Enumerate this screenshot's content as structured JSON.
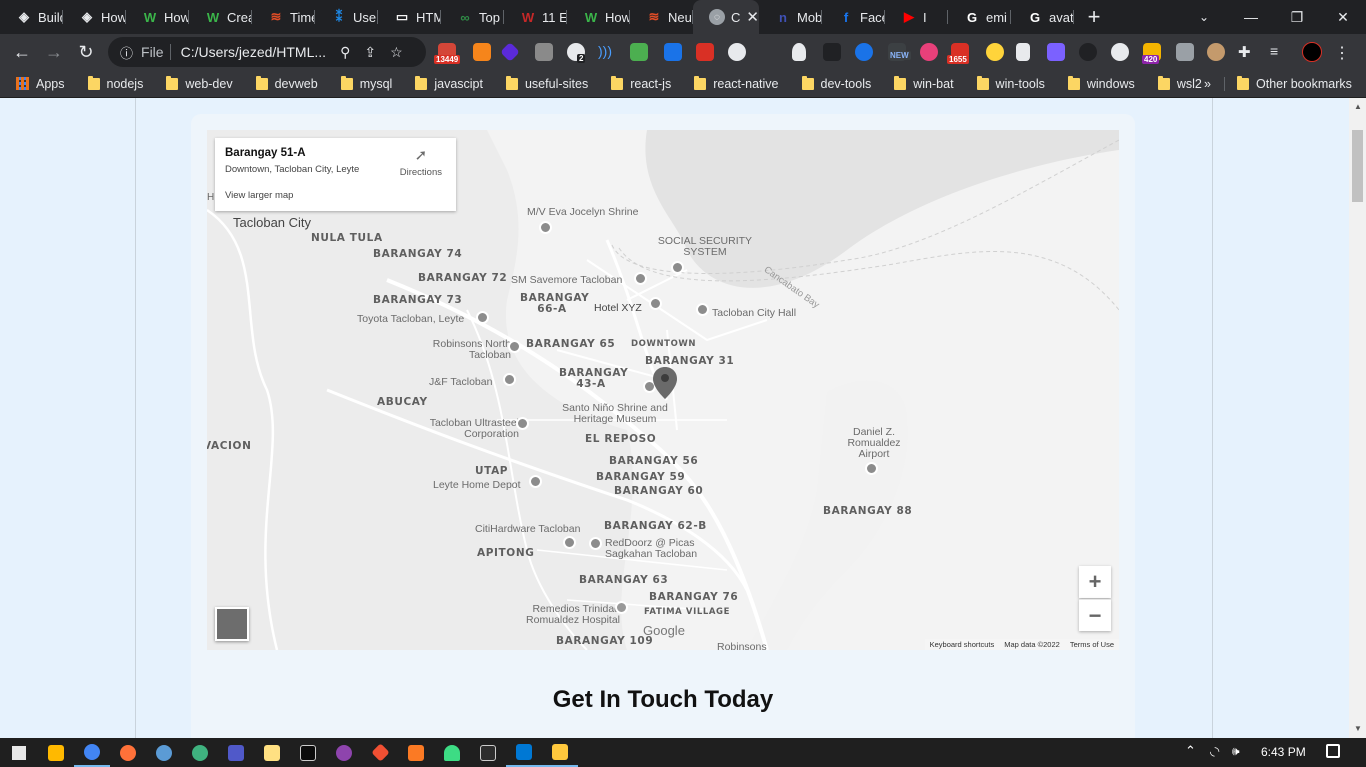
{
  "tabs": [
    {
      "label": "Build",
      "color": "#e8eaed",
      "glyph": "◈"
    },
    {
      "label": "How",
      "color": "#e8eaed",
      "glyph": "◈"
    },
    {
      "label": "How",
      "color": "#3bb54a",
      "glyph": "W"
    },
    {
      "label": "Crea",
      "color": "#3bb54a",
      "glyph": "W"
    },
    {
      "label": "Time",
      "color": "#e44d26",
      "glyph": "≋"
    },
    {
      "label": "User",
      "color": "#1e88e5",
      "glyph": "⁑"
    },
    {
      "label": "HTM",
      "color": "#f5f5f5",
      "glyph": "▭"
    },
    {
      "label": "Top",
      "color": "#2f8d46",
      "glyph": "∞"
    },
    {
      "label": "11 E",
      "color": "#c62828",
      "glyph": "W"
    },
    {
      "label": "How",
      "color": "#3bb54a",
      "glyph": "W"
    },
    {
      "label": "Neu",
      "color": "#e44d26",
      "glyph": "≋"
    }
  ],
  "active_tab": {
    "label": "C",
    "close": "✕"
  },
  "tabs_right": [
    {
      "label": "Mob",
      "color": "#3f51b5",
      "glyph": "n"
    },
    {
      "label": "Face",
      "color": "#1877f2",
      "glyph": "f"
    },
    {
      "label": "I",
      "color": "#ff0000",
      "glyph": "▶"
    },
    {
      "label": "emi",
      "color": "#ffffff",
      "glyph": "G"
    },
    {
      "label": "avat",
      "color": "#ffffff",
      "glyph": "G"
    }
  ],
  "new_tab": "+",
  "window_controls": {
    "minimize": "—",
    "restore": "❐",
    "close": "✕"
  },
  "address": {
    "prefix": "File",
    "url": "C:/Users/jezed/HTML..."
  },
  "ext_badges": {
    "mail": "13449",
    "num2": "2",
    "gmail": "1655",
    "count420": "420",
    "new": "NEW"
  },
  "bookmarks": [
    "Apps",
    "nodejs",
    "web-dev",
    "devweb",
    "mysql",
    "javascipt",
    "useful-sites",
    "react-js",
    "react-native",
    "dev-tools",
    "win-bat",
    "win-tools",
    "windows",
    "wsl2"
  ],
  "bookmarks_more": "»",
  "other_bookmarks": "Other bookmarks",
  "map": {
    "place_title": "Barangay 51-A",
    "place_address": "Downtown, Tacloban City, Leyte",
    "directions": "Directions",
    "view_larger": "View larger map",
    "city": "Tacloban City",
    "labels": [
      "NULA TULA",
      "BARANGAY 74",
      "BARANGAY 72",
      "BARANGAY 73",
      "BARANGAY 66-A",
      "BARANGAY 65",
      "DOWNTOWN",
      "BARANGAY 31",
      "BARANGAY 43-A",
      "ABUCAY",
      "VACION",
      "EL REPOSO",
      "BARANGAY 56",
      "BARANGAY 59",
      "BARANGAY 60",
      "UTAP",
      "BARANGAY 62-B",
      "APITONG",
      "BARANGAY 63",
      "BARANGAY 76",
      "FATIMA VILLAGE",
      "BARANGAY 109",
      "BARANGAY 88"
    ],
    "pois": [
      "M/V Eva Jocelyn Shrine",
      "SOCIAL SECURITY SYSTEM",
      "SM Savemore Tacloban",
      "Hotel XYZ",
      "Tacloban City Hall",
      "Toyota Tacloban, Leyte",
      "Robinsons North Tacloban",
      "J&F Tacloban",
      "Santo Niño Shrine and Heritage Museum",
      "Tacloban Ultrasteel Corporation",
      "Leyte Home Depot",
      "CitiHardware Tacloban",
      "RedDoorz @ Picas Sagkahan Tacloban",
      "Remedios Trinidad Romualdez Hospital",
      "Daniel Z. Romualdez Airport",
      "Robinsons"
    ],
    "bay": "Cancabato Bay",
    "h_letter": "H",
    "google": "Google",
    "footer": [
      "Keyboard shortcuts",
      "Map data ©2022",
      "Terms of Use"
    ],
    "zoom_in": "+",
    "zoom_out": "−"
  },
  "heading": "Get In Touch Today",
  "taskbar": {
    "time": "6:43 PM"
  }
}
